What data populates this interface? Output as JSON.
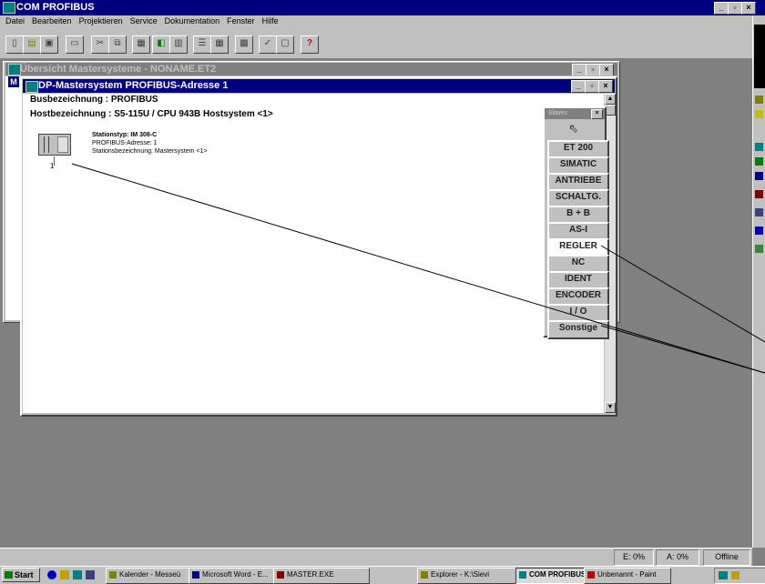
{
  "app": {
    "title": "COM PROFIBUS"
  },
  "menu": [
    "Datei",
    "Bearbeiten",
    "Projektieren",
    "Service",
    "Dokumentation",
    "Fenster",
    "Hilfe"
  ],
  "toolbar": {
    "help_glyph": "?"
  },
  "overview_window": {
    "title": "Übersicht Mastersysteme - NONAME.ET2"
  },
  "dp_window": {
    "title": "DP-Mastersystem PROFIBUS-Adresse 1",
    "bus_line": "Busbezeichnung : PROFIBUS",
    "host_line": "Hostbezeichnung : S5-115U / CPU 943B Hostsystem <1>",
    "station": {
      "type": "Stationstyp: IM 308-C",
      "address": "PROFIBUS-Adresse: 1",
      "name": "Stationsbezeichnung: Mastersystem <1>",
      "number": "1"
    }
  },
  "palette": {
    "title": "Slaves",
    "buttons": [
      "ET 200",
      "SIMATIC",
      "ANTRIEBE",
      "SCHALTG.",
      "B + B",
      "AS-I",
      "REGLER",
      "NC",
      "IDENT",
      "ENCODER",
      "I / O",
      "Sonstige"
    ],
    "active": "REGLER"
  },
  "status_bar": [
    "E: 0%",
    "A: 0%",
    "Offline"
  ],
  "taskbar": {
    "start": "Start",
    "tasks": [
      "Kalender - Messeü",
      "Microsoft Word - E...",
      "MASTER.EXE",
      "Explorer - K:\\Sievi",
      "COM PROFIBUS",
      "Unbenannt - Paint"
    ]
  }
}
